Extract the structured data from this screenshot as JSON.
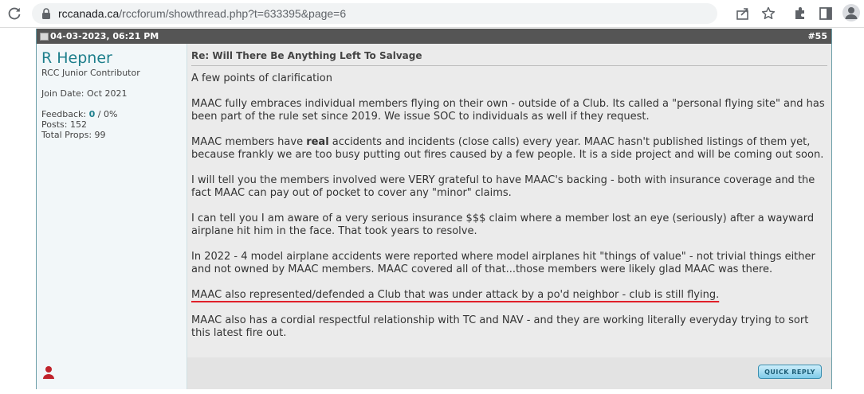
{
  "browser": {
    "url_domain": "rccanada.ca",
    "url_path": "/rccforum/showthread.php?t=633395&page=6"
  },
  "post": {
    "datetime": "04-03-2023, 06:21 PM",
    "number": "#55",
    "user": {
      "name": "R Hepner",
      "title": "RCC Junior Contributor",
      "join_date": "Join Date: Oct 2021",
      "feedback_label": "Feedback: ",
      "feedback_count": "0",
      "feedback_pct": " / 0%",
      "posts": "Posts: 152",
      "props": "Total Props: 99"
    },
    "title": "Re: Will There Be Anything Left To Salvage",
    "paragraphs": {
      "p1": "A few points of clarification",
      "p2": "MAAC fully embraces individual members flying on their own - outside of a Club. Its called a \"personal flying site\" and has been part of the rule set since 2019. We issue SOC to individuals as well if they request.",
      "p3_before": "MAAC members have ",
      "p3_bold": "real",
      "p3_after": " accidents and incidents (close calls) every year. MAAC hasn't published listings of them yet, because frankly we are too busy putting out fires caused by a few people. It is a side project and will be coming out soon.",
      "p4": "I will tell you the members involved were VERY grateful to have MAAC's backing - both with insurance coverage and the fact MAAC can pay out of pocket to cover any \"minor\" claims.",
      "p5": "I can tell you I am aware of a very serious insurance $$$ claim where a member lost an eye (seriously) after a wayward airplane hit him in the face. That took years to resolve.",
      "p6": "In 2022 - 4 model airplane accidents were reported where model airplanes hit \"things of value\" - not trivial things either and not owned by MAAC members. MAAC covered all of that...those members were likely glad MAAC was there.",
      "p7": "MAAC also represented/defended a Club that was under attack by a po'd neighbor - club is still flying.",
      "p8": "MAAC also has a cordial respectful relationship with TC and NAV - and they are working literally everyday trying to sort this latest fire out."
    },
    "quick_reply_label": "QUICK REPLY"
  },
  "colors": {
    "header_bar": "#555555",
    "username": "#1e7f8c",
    "underline": "#e0202a",
    "content_bg": "#ebebeb"
  }
}
